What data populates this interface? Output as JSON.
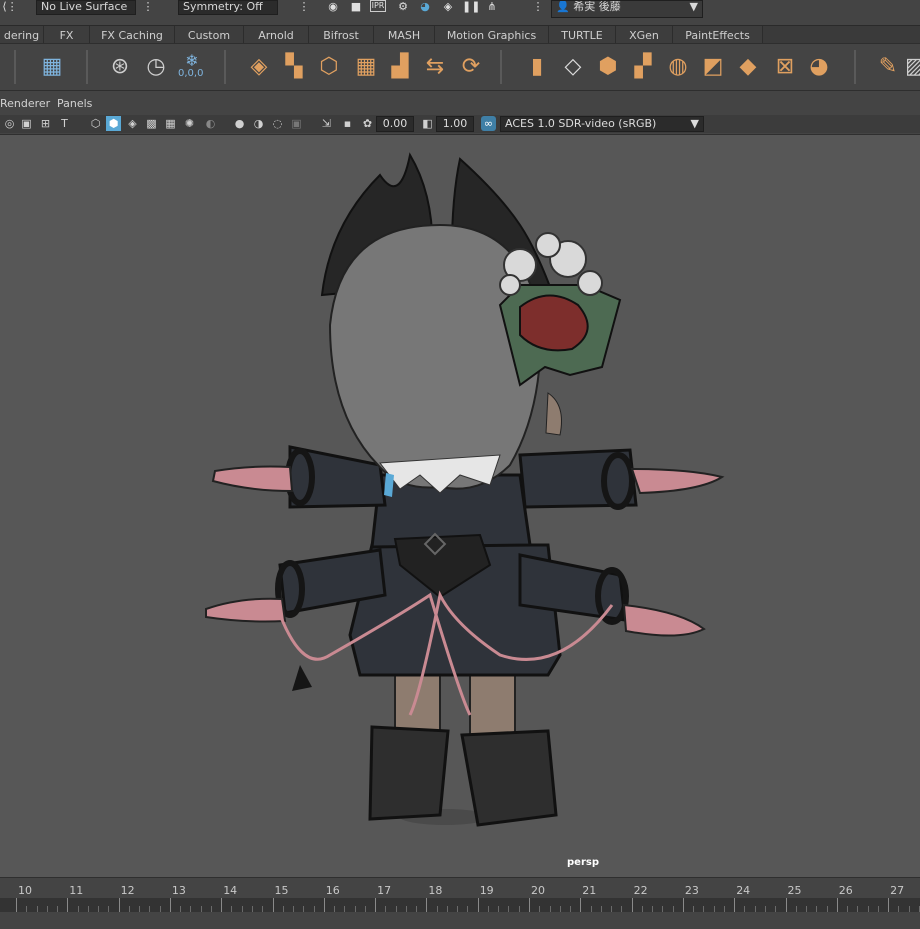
{
  "status_bar": {
    "live_surface": "No Live Surface",
    "symmetry": "Symmetry: Off",
    "user_name": "希実 後藤",
    "ipr_label": "IPR"
  },
  "shelf_tabs": [
    {
      "label": "dering"
    },
    {
      "label": "FX"
    },
    {
      "label": "FX Caching"
    },
    {
      "label": "Custom"
    },
    {
      "label": "Arnold"
    },
    {
      "label": "Bifrost"
    },
    {
      "label": "MASH"
    },
    {
      "label": "Motion Graphics"
    },
    {
      "label": "TURTLE"
    },
    {
      "label": "XGen"
    },
    {
      "label": "PaintEffects"
    }
  ],
  "shelf": {
    "coords_label": "0,0,0",
    "icons": [
      "hypershade-icon",
      "render-view-icon",
      "render-settings-icon",
      "snowflake-icon"
    ]
  },
  "panel_menu": {
    "renderer": "Renderer",
    "panels": "Panels"
  },
  "panel_toolbar": {
    "exposure": "0.00",
    "gamma": "1.00",
    "color_space": "ACES 1.0 SDR-video (sRGB)"
  },
  "viewport": {
    "camera": "persp"
  },
  "timeline": {
    "frames": [
      "10",
      "11",
      "12",
      "13",
      "14",
      "15",
      "16",
      "17",
      "18",
      "19",
      "20",
      "21",
      "22",
      "23",
      "24",
      "25",
      "26",
      "27"
    ]
  },
  "colors": {
    "accent_orange": "#e0a060",
    "accent_blue": "#5aa9d6",
    "viewport_bg": "#575757"
  }
}
